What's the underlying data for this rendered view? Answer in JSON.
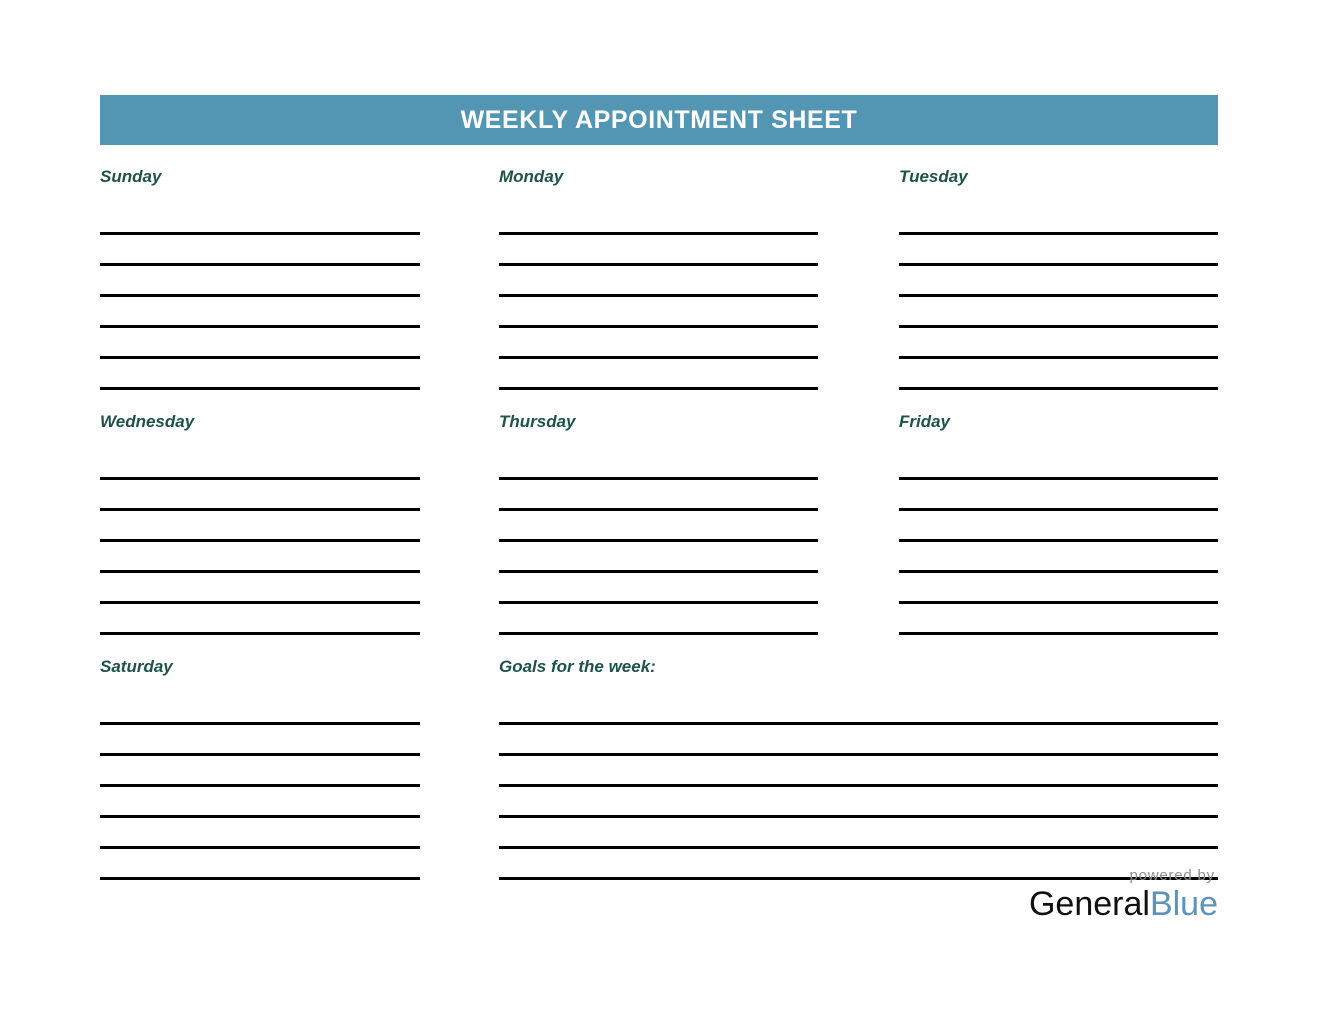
{
  "document": {
    "title": "WEEKLY APPOINTMENT SHEET",
    "accent_color": "#5296b3",
    "label_color": "#1f5348",
    "line_color": "#000000",
    "background_color": "#ffffff"
  },
  "blocks": [
    {
      "label": "Sunday",
      "lines": 6
    },
    {
      "label": "Monday",
      "lines": 6
    },
    {
      "label": "Tuesday",
      "lines": 6
    },
    {
      "label": "Wednesday",
      "lines": 6
    },
    {
      "label": "Thursday",
      "lines": 6
    },
    {
      "label": "Friday",
      "lines": 6
    },
    {
      "label": "Saturday",
      "lines": 6
    },
    {
      "label": "Goals for the week:",
      "lines": 6
    }
  ],
  "footer": {
    "powered_by": "powered by",
    "brand_first": "General",
    "brand_second": "Blue",
    "brand_second_color": "#5b94b8"
  }
}
